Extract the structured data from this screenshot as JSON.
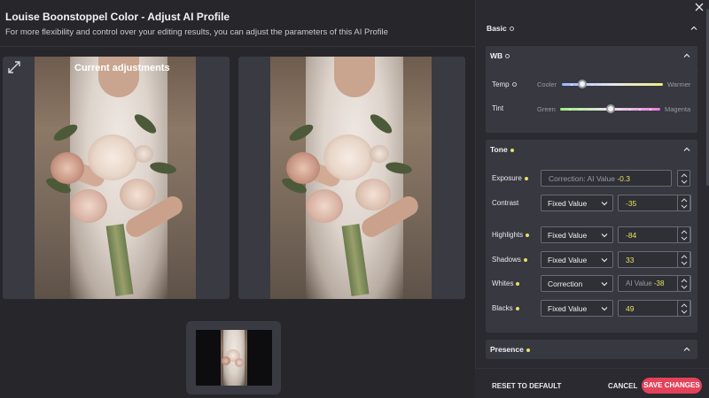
{
  "header": {
    "title": "Louise Boonstoppel Color - Adjust AI Profile",
    "subtitle": "For more flexibility and control over your editing results, you can adjust the parameters of this AI Profile"
  },
  "preview": {
    "left_label": "Current adjustments"
  },
  "panel": {
    "basic_label": "Basic",
    "wb": {
      "label": "WB",
      "temp": {
        "label": "Temp",
        "left": "Cooler",
        "right": "Warmer",
        "level": 0.2
      },
      "tint": {
        "label": "Tint",
        "left": "Green",
        "right": "Magenta",
        "level": 0.5
      }
    },
    "tone": {
      "label": "Tone",
      "exposure": {
        "label": "Exposure",
        "prefix": "Correction: AI Value",
        "value": "-0.3"
      },
      "contrast": {
        "label": "Contrast",
        "mode": "Fixed Value",
        "value": "-35"
      },
      "highlights": {
        "label": "Highlights",
        "mode": "Fixed Value",
        "value": "-84"
      },
      "shadows": {
        "label": "Shadows",
        "mode": "Fixed Value",
        "value": "33"
      },
      "whites": {
        "label": "Whites",
        "mode": "Correction",
        "prefix": "AI Value",
        "value": "-38"
      },
      "blacks": {
        "label": "Blacks",
        "mode": "Fixed Value",
        "value": "49"
      }
    },
    "presence_label": "Presence"
  },
  "footer": {
    "reset": "RESET TO DEFAULT",
    "cancel": "CANCEL",
    "save": "SAVE CHANGES"
  },
  "colors": {
    "accent": "#e4425a",
    "value_yellow": "#e8e060",
    "background": "#26262b",
    "panel": "#2a2a30"
  }
}
